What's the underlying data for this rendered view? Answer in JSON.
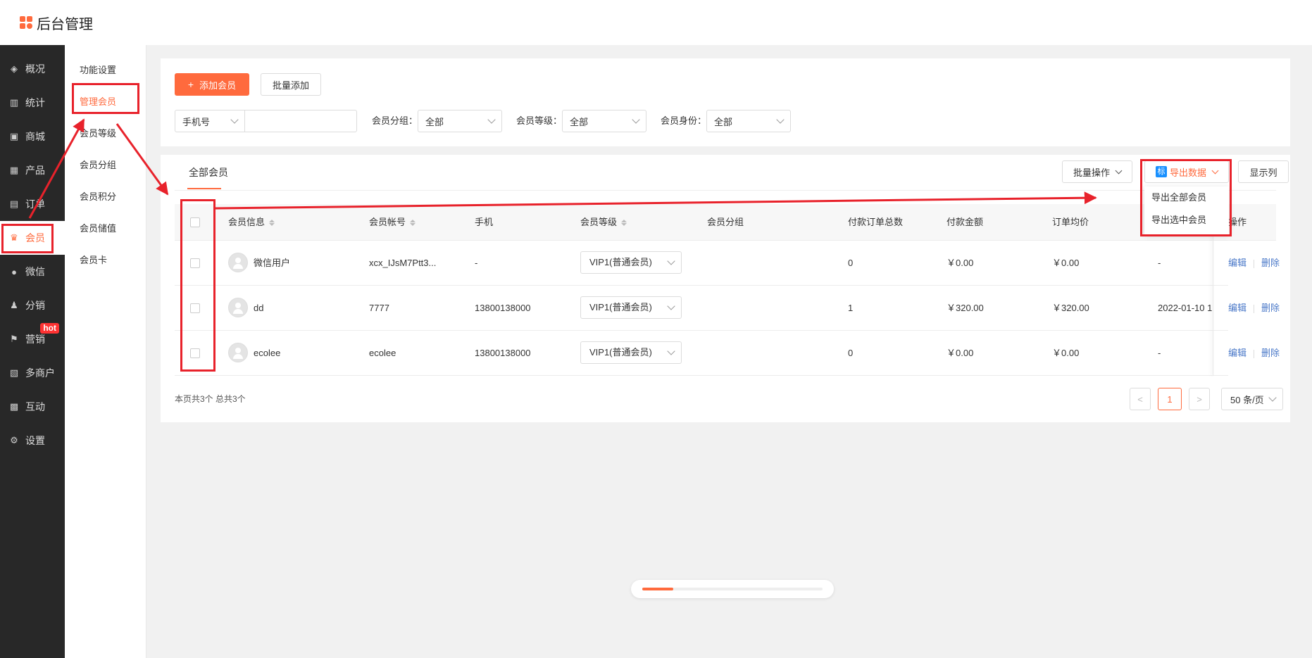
{
  "app": {
    "title": "后台管理"
  },
  "nav": {
    "items": [
      {
        "label": "概况",
        "icon": "layers-icon",
        "glyph": "◈"
      },
      {
        "label": "统计",
        "icon": "chart-icon",
        "glyph": "▥"
      },
      {
        "label": "商城",
        "icon": "store-icon",
        "glyph": "▣"
      },
      {
        "label": "产品",
        "icon": "grid-icon",
        "glyph": "▦"
      },
      {
        "label": "订单",
        "icon": "order-icon",
        "glyph": "▤"
      },
      {
        "label": "会员",
        "icon": "crown-icon",
        "glyph": "♛"
      },
      {
        "label": "微信",
        "icon": "wechat-icon",
        "glyph": "●"
      },
      {
        "label": "分销",
        "icon": "user-share-icon",
        "glyph": "♟"
      },
      {
        "label": "营销",
        "icon": "flag-icon",
        "glyph": "⚑",
        "badge": "hot"
      },
      {
        "label": "多商户",
        "icon": "merchant-icon",
        "glyph": "▧"
      },
      {
        "label": "互动",
        "icon": "interact-icon",
        "glyph": "▩"
      },
      {
        "label": "设置",
        "icon": "gear-icon",
        "glyph": "⚙"
      }
    ]
  },
  "subnav": {
    "items": [
      "功能设置",
      "管理会员",
      "会员等级",
      "会员分组",
      "会员积分",
      "会员储值",
      "会员卡"
    ]
  },
  "toolbar": {
    "add_label": "添加会员",
    "batch_add_label": "批量添加"
  },
  "filters": {
    "field_select": "手机号",
    "search_value": "",
    "group_label": "会员分组：",
    "group_value": "全部",
    "level_label": "会员等级：",
    "level_value": "全部",
    "identity_label": "会员身份：",
    "identity_value": "全部"
  },
  "list": {
    "tab": "全部会员",
    "batch_ops": "批量操作",
    "export_badge": "标",
    "export_label": "导出数据",
    "columns_label": "显示列",
    "export_menu": [
      "导出全部会员",
      "导出选中会员"
    ]
  },
  "table": {
    "headers": [
      "会员信息",
      "会员帐号",
      "手机",
      "会员等级",
      "会员分组",
      "付款订单总数",
      "付款金额",
      "订单均价",
      "操作"
    ],
    "rows": [
      {
        "name": "微信用户",
        "account": "xcx_IJsM7Ptt3...",
        "phone": "-",
        "level": "VIP1(普通会员)",
        "group": "",
        "orders": "0",
        "amount": "￥0.00",
        "avg": "￥0.00",
        "date": "-",
        "edit": "编辑",
        "del": "删除"
      },
      {
        "name": "dd",
        "account": "7777",
        "phone": "13800138000",
        "level": "VIP1(普通会员)",
        "group": "",
        "orders": "1",
        "amount": "￥320.00",
        "avg": "￥320.00",
        "date": "2022-01-10 1",
        "edit": "编辑",
        "del": "删除"
      },
      {
        "name": "ecolee",
        "account": "ecolee",
        "phone": "13800138000",
        "level": "VIP1(普通会员)",
        "group": "",
        "orders": "0",
        "amount": "￥0.00",
        "avg": "￥0.00",
        "date": "-",
        "edit": "编辑",
        "del": "删除"
      }
    ]
  },
  "pagination": {
    "summary": "本页共3个 总共3个",
    "prev": "<",
    "current": "1",
    "next": ">",
    "page_size": "50 条/页"
  },
  "loading": {
    "progress": 0.17
  },
  "colors": {
    "accent": "#ff6a3d",
    "sidebar": "#282828",
    "annotation": "#e8222b",
    "link": "#4a78c8"
  }
}
